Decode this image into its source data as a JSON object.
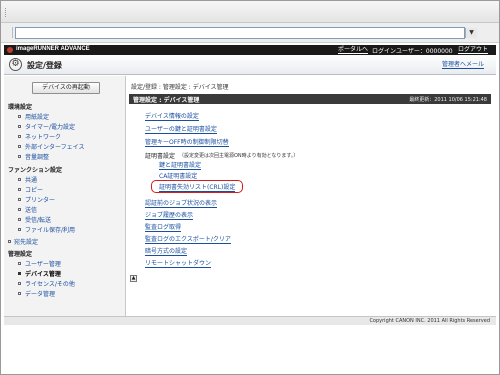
{
  "browser": {
    "address_value": "",
    "dropdown_glyph": "▼"
  },
  "header": {
    "brand": "imageRUNNER ADVANCE",
    "portal_link": "ポータルへ",
    "user_info": "ログインユーザー：0000000",
    "logout_link": "ログアウト",
    "page_title": "設定/登録",
    "title_icon": "⚙",
    "mail_link": "管理者へメール"
  },
  "sidebar": {
    "restart_button": "デバイスの再起動",
    "groups": [
      {
        "heading": "環境設定",
        "items": [
          "用紙設定",
          "タイマー/電力設定",
          "ネットワーク",
          "外部インターフェイス",
          "音量調整"
        ]
      },
      {
        "heading": "ファンクション設定",
        "items": [
          "共通",
          "コピー",
          "プリンター",
          "送信",
          "受信/転送",
          "ファイル保存/利用"
        ]
      },
      {
        "heading": "宛先設定",
        "items": []
      },
      {
        "heading": "管理設定",
        "items": [
          "ユーザー管理",
          "デバイス管理",
          "ライセンス/その他",
          "データ管理"
        ]
      }
    ],
    "active_item": "デバイス管理"
  },
  "main": {
    "breadcrumb": "設定/登録 : 管理設定 : デバイス管理",
    "section_title": "管理設定 : デバイス管理",
    "last_updated": "最終更新：2011 10/06 15:21:48",
    "links": {
      "device_info": "デバイス情報の設定",
      "user_key_cert": "ユーザーの鍵と証明書設定",
      "admin_off": "管理キーOFF時の制御制限切替",
      "cert_settings_label": "証明書設定",
      "cert_settings_note": "（設定変更は次回主電源ON時より有効となります。）",
      "key_cert": "鍵と証明書設定",
      "ca_cert": "CA証明書設定",
      "crl_settings": "証明書失効リスト(CRL)設定",
      "job_status": "認証前のジョブ状況の表示",
      "job_history": "ジョブ履歴の表示",
      "audit_log": "監査ログ取得",
      "audit_export": "監査ログのエクスポート/クリア",
      "encryption": "暗号方式の設定",
      "remote_shutdown": "リモートシャットダウン"
    },
    "to_top_glyph": "▲"
  },
  "footer": {
    "copyright": "Copyright CANON INC. 2011 All Rights Reserved"
  },
  "colors": {
    "header_dark": "#1a1a1a",
    "link_blue": "#1a4fa0",
    "highlight_red": "#d21f1f"
  }
}
